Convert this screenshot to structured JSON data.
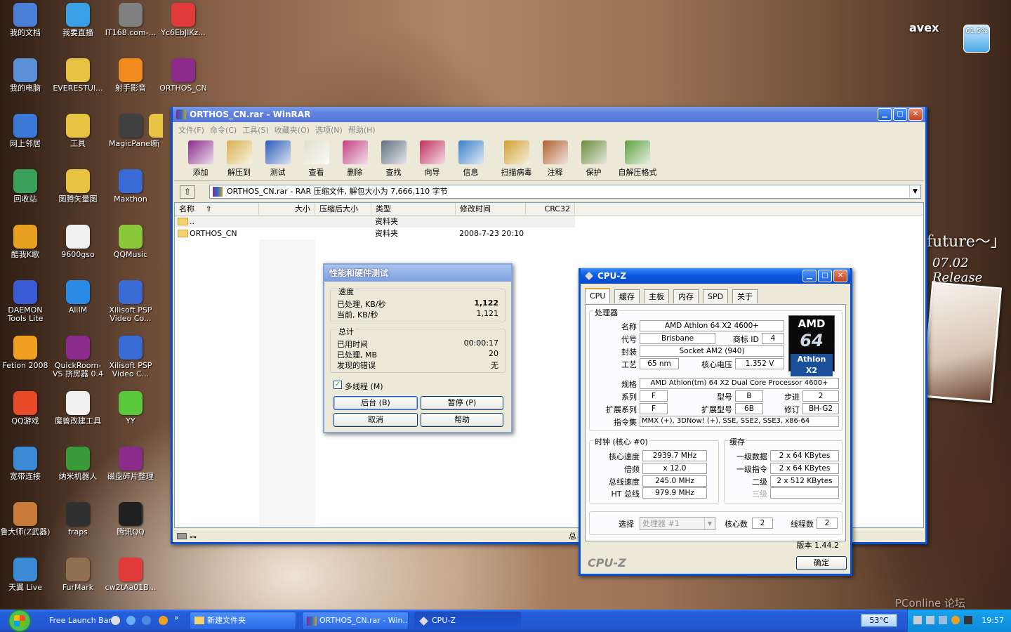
{
  "desktop": {
    "icons": [
      {
        "label": "我的文档",
        "color": "#4b7fd6"
      },
      {
        "label": "我要直播",
        "color": "#3aa0e6"
      },
      {
        "label": "IT168.com-...",
        "color": "#808080"
      },
      {
        "label": "Yc6EbJlKz...",
        "color": "#e03a3a"
      },
      {
        "label": "我的电脑",
        "color": "#5b8fd6"
      },
      {
        "label": "EVERESTUl...",
        "color": "#e8c243"
      },
      {
        "label": "射手影音",
        "color": "#f28a1f"
      },
      {
        "label": "ORTHOS_CN",
        "color": "#8b2b8b"
      },
      {
        "label": "网上邻居",
        "color": "#3a7ad6"
      },
      {
        "label": "工具",
        "color": "#e8c243"
      },
      {
        "label": "MagicPanel",
        "color": "#404040"
      },
      {
        "label": "新",
        "color": "#e8c243"
      },
      {
        "label": "回收站",
        "color": "#3aa05a"
      },
      {
        "label": "图腾矢量图",
        "color": "#e8c243"
      },
      {
        "label": "Maxthon",
        "color": "#3a6ad6"
      },
      {
        "label": "酷我K歌",
        "color": "#e8a020"
      },
      {
        "label": "9600gso",
        "color": "#f0f0f0"
      },
      {
        "label": "QQMusic",
        "color": "#8bc83a"
      },
      {
        "label": "DAEMON Tools Lite",
        "color": "#3a5ad6"
      },
      {
        "label": "AliIM",
        "color": "#2a8ae6"
      },
      {
        "label": "Xilisoft PSP Video Co...",
        "color": "#3a6ad6"
      },
      {
        "label": "Fetion 2008",
        "color": "#f0a020"
      },
      {
        "label": "QuickRoom-VS 挤房器 0.4",
        "color": "#8b2b8b"
      },
      {
        "label": "Xilisoft PSP Video C...",
        "color": "#3a6ad6"
      },
      {
        "label": "QQ游戏",
        "color": "#e84a2a"
      },
      {
        "label": "魔兽改建工具",
        "color": "#f0f0f0"
      },
      {
        "label": "YY",
        "color": "#5ac83a"
      },
      {
        "label": "宽带连接",
        "color": "#3a8ad6"
      },
      {
        "label": "纳米机器人",
        "color": "#3a9a3a"
      },
      {
        "label": "磁盘碎片整理",
        "color": "#8b2b8b"
      },
      {
        "label": "鲁大师(Z武器)",
        "color": "#c87a3a"
      },
      {
        "label": "fraps",
        "color": "#303030"
      },
      {
        "label": "腾讯QQ",
        "color": "#202020"
      },
      {
        "label": "天翼 Live",
        "color": "#3a8ad6"
      },
      {
        "label": "FurMark",
        "color": "#907050"
      },
      {
        "label": "cw2tAa01B...",
        "color": "#e03a3a"
      }
    ],
    "wallpaper_text": {
      "logo": "avex",
      "release_1": "future～」",
      "release_2": "07.02 Release",
      "gauge": "61.5%",
      "watermark": "PConline 论坛"
    }
  },
  "winrar": {
    "title": "ORTHOS_CN.rar - WinRAR",
    "menu": [
      "文件(F)",
      "命令(C)",
      "工具(S)",
      "收藏夹(O)",
      "选项(N)",
      "帮助(H)"
    ],
    "toolbar": [
      "添加",
      "解压到",
      "测试",
      "查看",
      "删除",
      "查找",
      "向导",
      "信息",
      "扫描病毒",
      "注释",
      "保护",
      "自解压格式"
    ],
    "path": "ORTHOS_CN.rar - RAR 压缩文件, 解包大小为 7,666,110 字节",
    "columns": [
      "名称",
      "大小",
      "压缩后大小",
      "类型",
      "修改时间",
      "CRC32"
    ],
    "rows": [
      {
        "name": "..",
        "type": "资料夹",
        "modified": ""
      },
      {
        "name": "ORTHOS_CN",
        "type": "资料夹",
        "modified": "2008-7-23 20:10"
      }
    ],
    "status": "总"
  },
  "perf": {
    "title": "性能和硬件测试",
    "speed_label": "速度",
    "processed_label": "已处理, KB/秒",
    "processed_value": "1,122",
    "current_label": "当前, KB/秒",
    "current_value": "1,121",
    "total_label": "总计",
    "elapsed_label": "已用时间",
    "elapsed_value": "00:00:17",
    "processed_mb_label": "已处理, MB",
    "processed_mb_value": "20",
    "errors_label": "发现的错误",
    "errors_value": "无",
    "multithread_label": "多线程 (M)",
    "btn_background": "后台 (B)",
    "btn_pause": "暂停 (P)",
    "btn_cancel": "取消",
    "btn_help": "帮助"
  },
  "cpuz": {
    "title": "CPU-Z",
    "tabs": [
      "CPU",
      "缓存",
      "主板",
      "内存",
      "SPD",
      "关于"
    ],
    "processor_label": "处理器",
    "name_label": "名称",
    "name": "AMD Athlon 64 X2 4600+",
    "codename_label": "代号",
    "codename": "Brisbane",
    "brandid_label": "商标 ID",
    "brandid": "4",
    "package_label": "封装",
    "package": "Socket AM2 (940)",
    "tech_label": "工艺",
    "tech": "65 nm",
    "voltage_label": "核心电压",
    "voltage": "1.352 V",
    "spec_label": "规格",
    "spec": "AMD Athlon(tm) 64 X2 Dual Core Processor 4600+",
    "family_label": "系列",
    "family": "F",
    "model_label": "型号",
    "model": "B",
    "stepping_label": "步进",
    "stepping": "2",
    "extfamily_label": "扩展系列",
    "extfamily": "F",
    "extmodel_label": "扩展型号",
    "extmodel": "6B",
    "revision_label": "修订",
    "revision": "BH-G2",
    "instr_label": "指令集",
    "instr": "MMX (+), 3DNow! (+), SSE, SSE2, SSE3, x86-64",
    "logo": {
      "brand": "AMD",
      "bits": "64",
      "line": "Athlon X2"
    },
    "clocks_label": "时钟 (核心 #0)",
    "core_speed_label": "核心速度",
    "core_speed": "2939.7 MHz",
    "multiplier_label": "倍频",
    "multiplier": "x 12.0",
    "bus_label": "总线速度",
    "bus": "245.0 MHz",
    "ht_label": "HT 总线",
    "ht": "979.9 MHz",
    "cache_label": "缓存",
    "l1d_label": "一级数据",
    "l1d": "2 x 64 KBytes",
    "l1i_label": "一级指令",
    "l1i": "2 x 64 KBytes",
    "l2_label": "二级",
    "l2": "2 x 512 KBytes",
    "l3_label": "三级",
    "l3": "",
    "select_label": "选择",
    "select_value": "处理器 #1",
    "cores_label": "核心数",
    "cores": "2",
    "threads_label": "线程数",
    "threads": "2",
    "version": "版本 1.44.2",
    "brand": "CPU-Z",
    "ok": "确定"
  },
  "taskbar": {
    "launch": "Free Launch Bar",
    "tasks": [
      "新建文件夹",
      "ORTHOS_CN.rar - Win...",
      "CPU-Z"
    ],
    "temp": "53°C",
    "time": "19:57"
  }
}
